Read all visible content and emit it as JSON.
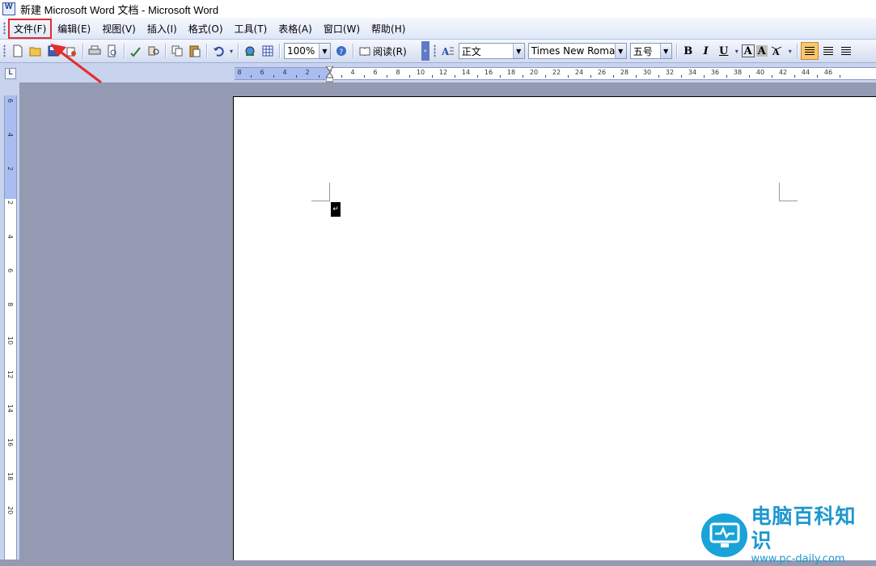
{
  "window": {
    "title": "新建 Microsoft Word 文档 - Microsoft Word"
  },
  "menubar": {
    "items": [
      {
        "label": "文件(F)"
      },
      {
        "label": "编辑(E)"
      },
      {
        "label": "视图(V)"
      },
      {
        "label": "插入(I)"
      },
      {
        "label": "格式(O)"
      },
      {
        "label": "工具(T)"
      },
      {
        "label": "表格(A)"
      },
      {
        "label": "窗口(W)"
      },
      {
        "label": "帮助(H)"
      }
    ]
  },
  "toolbar": {
    "zoom": "100%",
    "read_label": "阅读(R)",
    "style": "正文",
    "font": "Times New Roman",
    "size": "五号",
    "bold": "B",
    "italic": "I",
    "underline": "U",
    "font_color": "A",
    "char_shading": "A"
  },
  "ruler": {
    "horizontal_labels": [
      "8",
      "6",
      "4",
      "2",
      "2",
      "4",
      "6",
      "8",
      "10",
      "12",
      "14",
      "16",
      "18",
      "20",
      "22",
      "24",
      "26",
      "28",
      "30",
      "32",
      "34",
      "36",
      "38",
      "40",
      "42",
      "44",
      "46"
    ],
    "vertical_labels": [
      "6",
      "4",
      "2",
      "2",
      "4",
      "6",
      "8",
      "10",
      "12",
      "14",
      "16",
      "18",
      "20"
    ],
    "tab_selector": "L"
  },
  "document": {
    "paragraph_mark": "↵"
  },
  "watermark": {
    "name": "电脑百科知识",
    "url": "www.pc-daily.com"
  },
  "colors": {
    "annotation_red": "#e42d2d",
    "workspace": "#939ab1",
    "logo_blue": "#19a3d8"
  }
}
